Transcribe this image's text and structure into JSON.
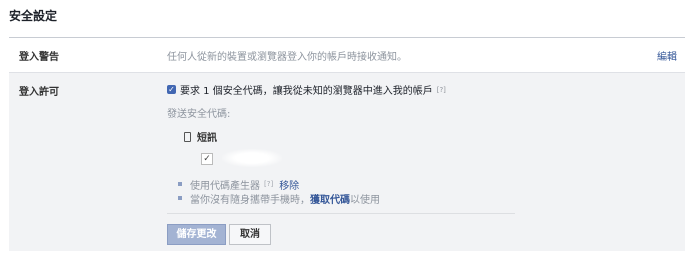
{
  "page": {
    "title": "安全設定"
  },
  "login_alerts": {
    "label": "登入警告",
    "description": "任何人從新的裝置或瀏覽器登入你的帳戶時接收通知。",
    "edit_label": "編輯"
  },
  "login_approvals": {
    "label": "登入許可",
    "require_code_text": "要求 1 個安全代碼，讓我從未知的瀏覽器中進入我的帳戶",
    "require_code_checked": true,
    "help_mark": "[?]",
    "send_code_label": "發送安全代碼:",
    "method_label": "短訊",
    "phone_checked": true,
    "code_generator": {
      "text": "使用代碼產生器",
      "help_mark": "[?]",
      "remove_label": "移除"
    },
    "no_phone": {
      "before": "當你沒有隨身攜帶手機時，",
      "link": "獲取代碼",
      "after": "以使用"
    },
    "save_label": "儲存更改",
    "cancel_label": "取消"
  },
  "colors": {
    "link": "#365899",
    "save_button": "#a3b3d3",
    "section_background": "#f2f3f5"
  }
}
